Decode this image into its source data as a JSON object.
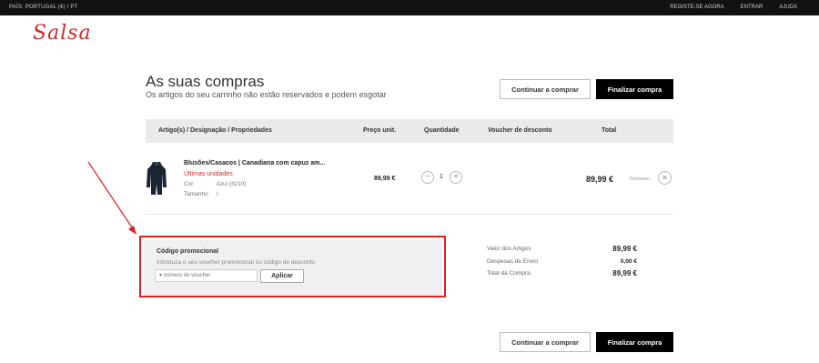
{
  "topbar": {
    "country": "PAÍS: PORTUGAL (€) / PT",
    "links": [
      "REGISTE-SE AGORA",
      "ENTRAR",
      "AJUDA"
    ]
  },
  "logo": "Salsa",
  "header": {
    "title": "As suas compras",
    "subtitle": "Os artigos do seu carrinho não estão reservados e podem esgotar",
    "continue_label": "Continuar a comprar",
    "checkout_label": "Finalizar compra"
  },
  "table": {
    "headers": [
      "Artigo(s) / Designação / Propriedades",
      "Preço unit.",
      "Quantidade",
      "Voucher de desconto",
      "Total"
    ]
  },
  "product": {
    "name": "Blusões/Casacos | Canadiana com capuz am...",
    "stock": "Últimas unidades",
    "color_label": "Cor",
    "color_value": "Azul (8210)",
    "size_label": "Tamanho",
    "size_value": "I",
    "unit_price": "89,99 €",
    "quantity": "1",
    "total": "89,99 €",
    "remove_label": "Remover"
  },
  "promo": {
    "title": "Código promocional",
    "description": "Introduza o seu voucher promocional ou código de desconto",
    "placeholder": "▾ número do voucher",
    "apply_label": "Aplicar"
  },
  "summary": {
    "items_label": "Valor dos Artigos",
    "items_value": "89,99 €",
    "shipping_label": "Despesas de Envio",
    "shipping_value": "0,00 €",
    "total_label": "Total da Compra",
    "total_value": "89,99 €"
  },
  "colors": {
    "brand": "#d4292a",
    "highlight": "#e02020",
    "dark": "#000000"
  }
}
